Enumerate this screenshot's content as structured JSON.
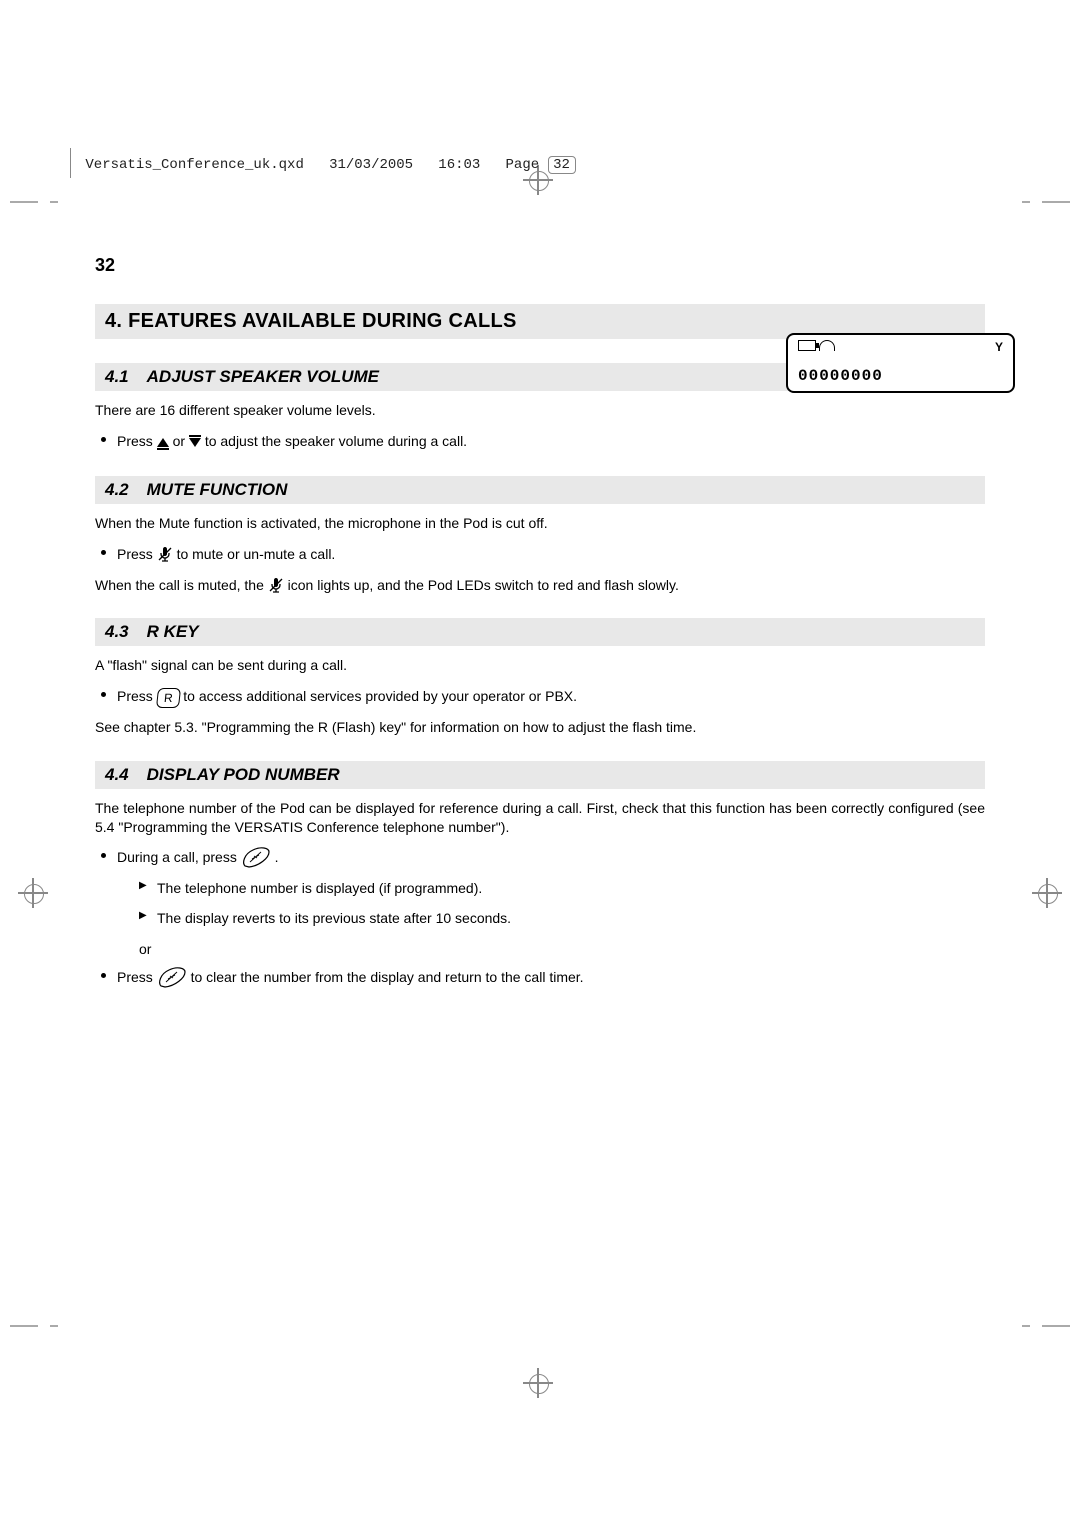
{
  "imposition": {
    "filename": "Versatis_Conference_uk.qxd",
    "date": "31/03/2005",
    "time": "16:03",
    "page_word": "Page",
    "page_num": "32"
  },
  "page_number": "32",
  "heading_main": "4.   FEATURES AVAILABLE DURING CALLS",
  "s41": {
    "num": "4.1",
    "title": "ADJUST SPEAKER VOLUME",
    "p1": "There are 16 different speaker volume levels.",
    "b1a": "Press ",
    "b1b": " or ",
    "b1c": " to adjust the speaker volume during a call."
  },
  "s42": {
    "num": "4.2",
    "title": "MUTE FUNCTION",
    "p1": "When the Mute function is activated, the microphone in the Pod is cut off.",
    "b1a": "Press ",
    "b1b": " to mute or un-mute a call.",
    "p2a": "When the call is muted, the ",
    "p2b": " icon lights up, and the Pod LEDs switch to red and flash slowly."
  },
  "s43": {
    "num": "4.3",
    "title": "R KEY",
    "p1": "A \"flash\" signal can be sent during a call.",
    "b1a": "Press ",
    "b1b": " to access additional services provided by your operator or PBX.",
    "r_label": "R",
    "p2": "See chapter 5.3. \"Programming the R (Flash) key\" for information on how to adjust the flash time."
  },
  "s44": {
    "num": "4.4",
    "title": "DISPLAY POD NUMBER",
    "p1": "The telephone number of the Pod can be displayed for reference during a call. First, check that this function has been correctly configured (see 5.4 \"Programming the VERSATIS Conference telephone number\").",
    "b1a": "During a call, press ",
    "b1b": ".",
    "sub1": "The telephone number is displayed (if programmed).",
    "sub2": "The display reverts to its previous state after 10 seconds.",
    "or": "or",
    "b2a": "Press ",
    "b2b": " to clear the number from the display and return to the call timer."
  },
  "lcd": {
    "digits": "00000000",
    "antenna": "Y"
  }
}
